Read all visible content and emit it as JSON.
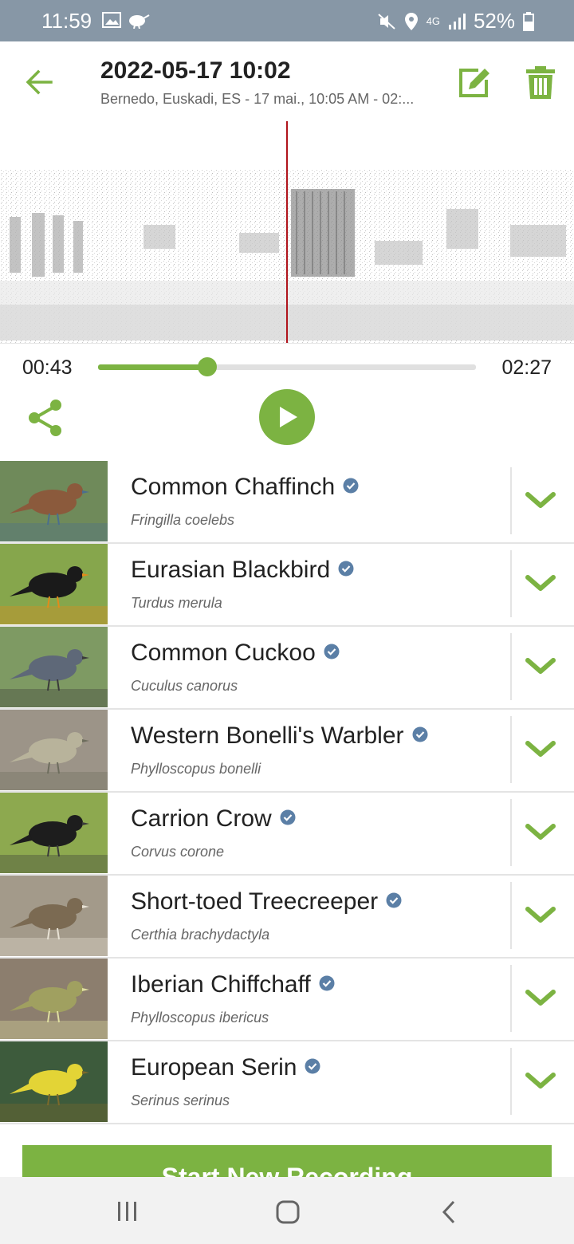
{
  "status_bar": {
    "time": "11:59",
    "battery": "52%",
    "network": "4G"
  },
  "header": {
    "title": "2022-05-17 10:02",
    "subtitle": "Bernedo, Euskadi, ES - 17 mai., 10:05 AM - 02:..."
  },
  "player": {
    "current_time": "00:43",
    "total_time": "02:27",
    "progress": 0.29
  },
  "species": [
    {
      "name": "Common Chaffinch",
      "scientific": "Fringilla coelebs"
    },
    {
      "name": "Eurasian Blackbird",
      "scientific": "Turdus merula"
    },
    {
      "name": "Common Cuckoo",
      "scientific": "Cuculus canorus"
    },
    {
      "name": "Western Bonelli's Warbler",
      "scientific": "Phylloscopus bonelli"
    },
    {
      "name": "Carrion Crow",
      "scientific": "Corvus corone"
    },
    {
      "name": "Short-toed Treecreeper",
      "scientific": "Certhia brachydactyla"
    },
    {
      "name": "Iberian Chiffchaff",
      "scientific": "Phylloscopus ibericus"
    },
    {
      "name": "European Serin",
      "scientific": "Serinus serinus"
    }
  ],
  "actions": {
    "start_recording": "Start New Recording"
  },
  "colors": {
    "accent": "#7cb342",
    "status_bar": "#8797a6",
    "playhead": "#b0141c",
    "verified": "#5b7fa6"
  }
}
